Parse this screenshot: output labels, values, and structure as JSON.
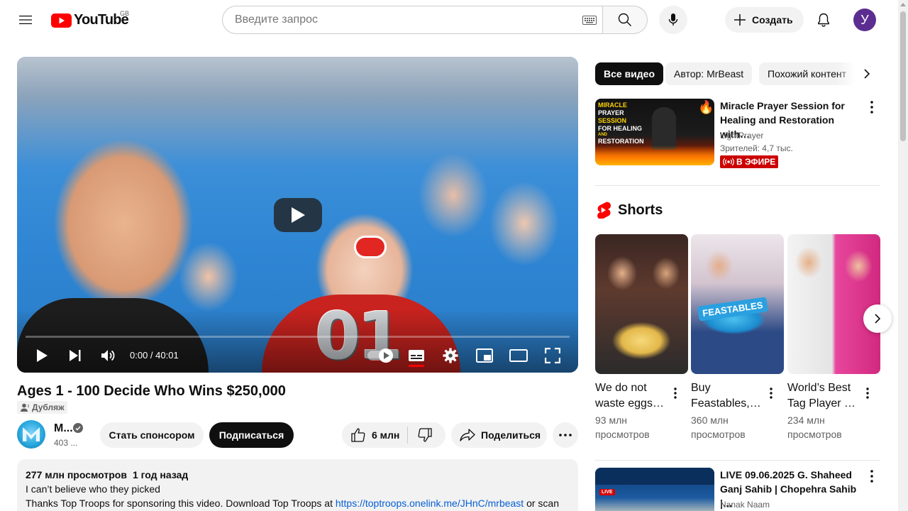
{
  "header": {
    "logo_text": "YouTube",
    "country_code": "GB",
    "search_placeholder": "Введите запрос",
    "create_label": "Создать",
    "avatar_letter": "У"
  },
  "player": {
    "time": "0:00 / 40:01",
    "thumbnail_number": "01",
    "progress_fraction": 0
  },
  "video": {
    "title": "Ages 1 - 100 Decide Who Wins $250,000",
    "dub_label": "Дубляж",
    "channel_name": "M...",
    "subscribers": "403 ...",
    "sponsor_label": "Стать спонсором",
    "subscribe_label": "Подписаться",
    "likes": "6 млн",
    "share_label": "Поделиться"
  },
  "description": {
    "views": "277 млн просмотров",
    "date": "1 год назад",
    "line1": "I can’t believe who they picked",
    "line2_prefix": "Thanks Top Troops for sponsoring this video. Download Top Troops at ",
    "link": "https://toptroops.onelink.me/JHnC/mrbeast",
    "line2_suffix": " or scan"
  },
  "chips": [
    "Все видео",
    "Автор: MrBeast",
    "Похожий контент"
  ],
  "recommended": [
    {
      "title": "Miracle Prayer Session for Healing and Restoration with…",
      "channel": "LightPrayer",
      "meta": "Зрителей: 4,7 тыс.",
      "badge": "В ЭФИРЕ",
      "thumb_text": [
        "MIRACLE",
        "PRAYER",
        "SESSION",
        "FOR HEALING",
        "AND",
        "RESTORATION"
      ]
    },
    {
      "title": "LIVE 09.06.2025 G. Shaheed Ganj Sahib | Chopehra Sahib |…",
      "channel": "Nanak Naam"
    }
  ],
  "shorts": {
    "heading": "Shorts",
    "items": [
      {
        "title1": "We do not",
        "title2": "waste eggs…",
        "views1": "93 млн",
        "views2": "просмотров"
      },
      {
        "title1": "Buy",
        "title2": "Feastables,…",
        "views1": "360 млн",
        "views2": "просмотров",
        "thumb_label": "FEASTABLES"
      },
      {
        "title1": "World’s Best",
        "title2": "Tag Player …",
        "views1": "234 млн",
        "views2": "просмотров"
      }
    ]
  },
  "colors": {
    "brand_red": "#ff0000",
    "link_blue": "#065fd4",
    "live_red": "#cc0000",
    "avatar_purple": "#5c2d91"
  }
}
